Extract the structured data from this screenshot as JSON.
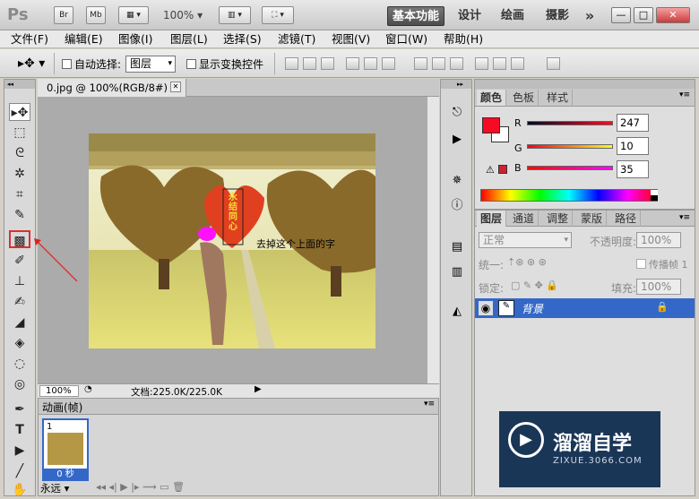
{
  "appbar": {
    "logo": "Ps",
    "bridge_label": "Br",
    "minibridge_label": "Mb",
    "zoom": "100%",
    "workspaces": [
      "基本功能",
      "设计",
      "绘画",
      "摄影"
    ],
    "more": "»",
    "window_controls": [
      "—",
      "□",
      "✕"
    ]
  },
  "menubar": {
    "items": [
      "文件(F)",
      "编辑(E)",
      "图像(I)",
      "图层(L)",
      "选择(S)",
      "滤镜(T)",
      "视图(V)",
      "窗口(W)",
      "帮助(H)"
    ]
  },
  "options": {
    "auto_select_label": "自动选择:",
    "auto_select_value": "图层",
    "show_transform_label": "显示变换控件"
  },
  "document": {
    "tab_title": "0.jpg @ 100%(RGB/8#)",
    "close": "✕",
    "sign_text": "永结同心",
    "annotation": "去掉这个上面的字",
    "zoom": "100%",
    "doc_size": "文档:225.0K/225.0K"
  },
  "animation": {
    "title": "动画(帧)",
    "frame_number": "1",
    "frame_delay": "0 秒",
    "loop": "永远"
  },
  "color_panel": {
    "tabs": [
      "颜色",
      "色板",
      "样式"
    ],
    "channels": [
      {
        "label": "R",
        "value": "247"
      },
      {
        "label": "G",
        "value": "10"
      },
      {
        "label": "B",
        "value": "35"
      }
    ],
    "foreground": "#f70a23"
  },
  "layers_panel": {
    "tabs": [
      "图层",
      "通道",
      "调整",
      "蒙版",
      "路径"
    ],
    "blend_mode": "正常",
    "opacity_label": "不透明度:",
    "opacity_value": "100%",
    "unify_label": "统一:",
    "propagate_label": "传播帧 1",
    "lock_label": "锁定:",
    "fill_label": "填充:",
    "fill_value": "100%",
    "layer_name": "背景"
  },
  "watermark": {
    "brand": "溜溜自学",
    "site": "ZIXUE.3066.COM"
  },
  "colors": {
    "accent": "#3468c8",
    "annotation": "#e02020"
  }
}
